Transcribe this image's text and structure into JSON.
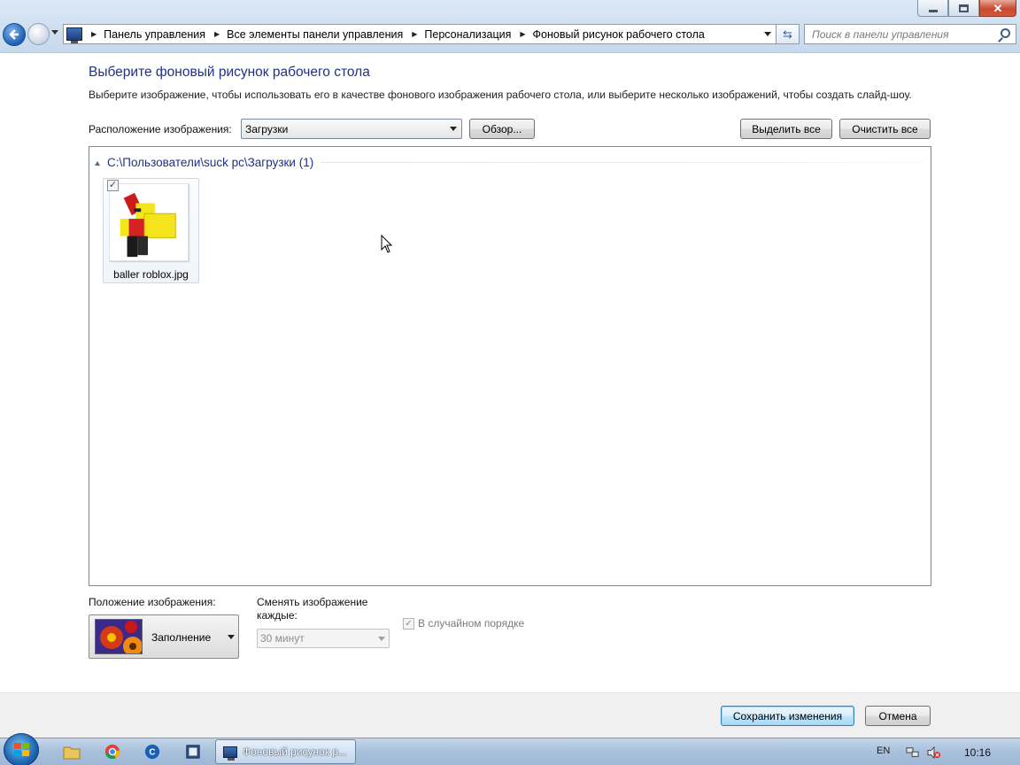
{
  "window": {
    "address": {
      "crumbs": [
        "Панель управления",
        "Все элементы панели управления",
        "Персонализация",
        "Фоновый рисунок рабочего стола"
      ]
    },
    "search": {
      "placeholder": "Поиск в панели управления"
    }
  },
  "content": {
    "title": "Выберите фоновый рисунок рабочего стола",
    "subtitle": "Выберите изображение, чтобы использовать его в качестве фонового изображения рабочего стола, или выберите несколько изображений, чтобы создать слайд-шоу.",
    "location_label": "Расположение изображения:",
    "location_value": "Загрузки",
    "browse_label": "Обзор...",
    "select_all_label": "Выделить все",
    "clear_all_label": "Очистить все",
    "group_header": "C:\\Пользователи\\suck pc\\Загрузки (1)",
    "images": [
      {
        "filename": "baller roblox.jpg",
        "checked": true
      }
    ],
    "position_label": "Положение изображения:",
    "position_value": "Заполнение",
    "interval_label_1": "Сменять изображение",
    "interval_label_2": "каждые:",
    "interval_value": "30 минут",
    "shuffle_label": "В случайном порядке",
    "shuffle_checked": true
  },
  "footer": {
    "save_label": "Сохранить изменения",
    "cancel_label": "Отмена"
  },
  "taskbar": {
    "active_window_title": "Фоновый рисунок р...",
    "language": "EN",
    "clock": "10:16"
  },
  "colors": {
    "heading": "#1e3287",
    "titlebar": "#cfdff0"
  }
}
